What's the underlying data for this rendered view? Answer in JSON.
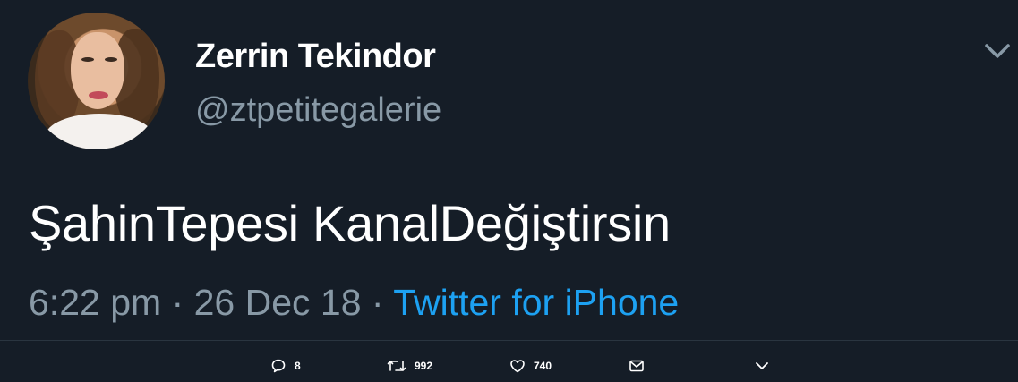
{
  "user": {
    "display_name": "Zerrin Tekindor",
    "handle": "@ztpetitegalerie",
    "avatar": "profile-photo"
  },
  "tweet": {
    "text": "ŞahinTepesi KanalDeğiştirsin",
    "time": "6:22 pm",
    "separator1": " · ",
    "date": "26 Dec 18",
    "separator2": " · ",
    "source": "Twitter for iPhone"
  },
  "actions": {
    "reply_count": "8",
    "retweet_count": "992",
    "like_count": "740"
  },
  "icons": {
    "top_menu": "chevron-down-icon",
    "reply": "reply-icon",
    "retweet": "retweet-icon",
    "like": "heart-icon",
    "message": "envelope-icon",
    "more": "chevron-down-icon"
  },
  "colors": {
    "background": "#151d27",
    "link": "#1da1f2",
    "muted": "#8899a6"
  }
}
